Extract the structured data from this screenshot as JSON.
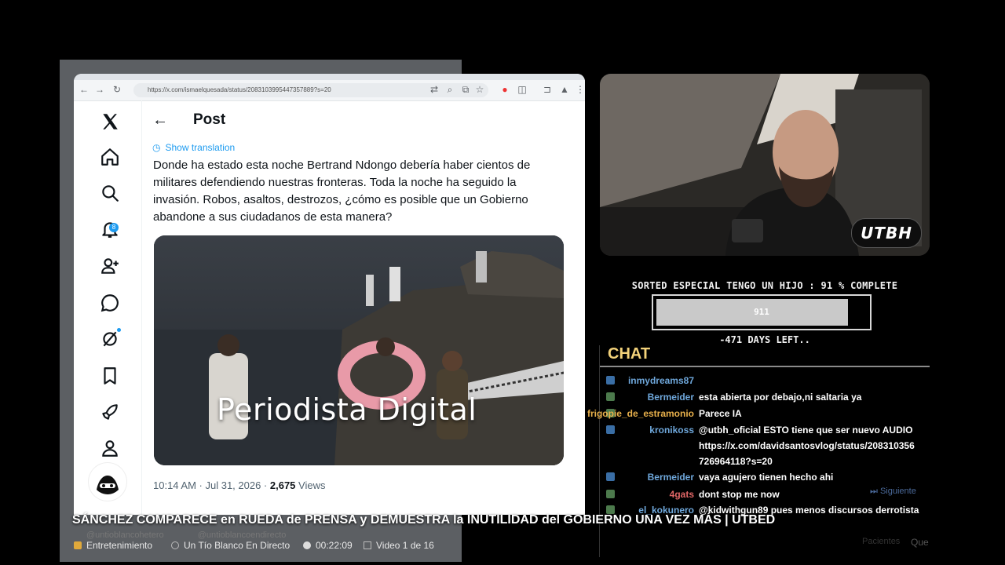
{
  "browser": {
    "url": "https://x.com/ismaelquesada/status/2083103995447357889?s=20"
  },
  "x_post": {
    "header_title": "Post",
    "show_translation": "Show translation",
    "text": "Donde ha estado esta noche Bertrand Ndongo debería haber cientos de militares defendiendo nuestras fronteras. Toda la noche ha seguido la invasión. Robos, asaltos, destrozos, ¿cómo es posible que un Gobierno abandone a sus ciudadanos de esta manera?",
    "media_caption": "Periodista Digital",
    "time_date": "10:14 AM · Jul 31, 2026 · ",
    "views_count": "2,675",
    "views_label": " Views",
    "notification_count": "8"
  },
  "webcam": {
    "badge": "UTBH"
  },
  "progress": {
    "title": "SORTED ESPECIAL TENGO UN HIJO :  91 % COMPLETE",
    "value_label": "911",
    "percent": 91,
    "days_left": "-471 DAYS LEFT.."
  },
  "chat": {
    "heading": "CHAT",
    "messages": [
      {
        "user": "inmydreams87",
        "user_color": "#6fa8dc",
        "text": ""
      },
      {
        "user": "Bermeider",
        "user_color": "#6fa8dc",
        "text": "esta abierta por debajo,ni saltaria ya"
      },
      {
        "user": "frigopie_de_estramonio",
        "user_color": "#e8b04b",
        "text": "Parece IA"
      },
      {
        "user": "kronikoss",
        "user_color": "#6fa8dc",
        "text": "@utbh_oficial ESTO tiene que ser nuevo AUDIO"
      },
      {
        "user": "",
        "user_color": "#6fa8dc",
        "text": "https://x.com/davidsantosvlog/status/208310356"
      },
      {
        "user": "",
        "user_color": "#6fa8dc",
        "text": "726964118?s=20"
      },
      {
        "user": "Bermeider",
        "user_color": "#6fa8dc",
        "text": "vaya agujero tienen hecho ahi"
      },
      {
        "user": "4gats",
        "user_color": "#e06666",
        "text": "dont stop me now"
      },
      {
        "user": "el_kokunero",
        "user_color": "#6fa8dc",
        "text": "@kidwithgun89 pues menos discursos derrotista"
      }
    ],
    "siguiente": "Siguiente",
    "pacientes": "Pacientes",
    "que": "Que"
  },
  "overlay": {
    "headline": "SÁNCHEZ COMPARECE en RUEDA de PRENSA y DEMUESTRA la INUTILIDAD del GOBIERNO UNA VEZ MÁS | UTBED",
    "category": "Entretenimiento",
    "channel": "Un Tío Blanco En Directo",
    "duration": "00:22:09",
    "video_index": "Video 1 de 16",
    "watermark_1": "@untioblancohetero",
    "watermark_2": "@untioblancoendirecto"
  },
  "colors": {
    "x_blue": "#1d9bf0",
    "chat_heading": "#f3d27a",
    "background": "#000000"
  }
}
